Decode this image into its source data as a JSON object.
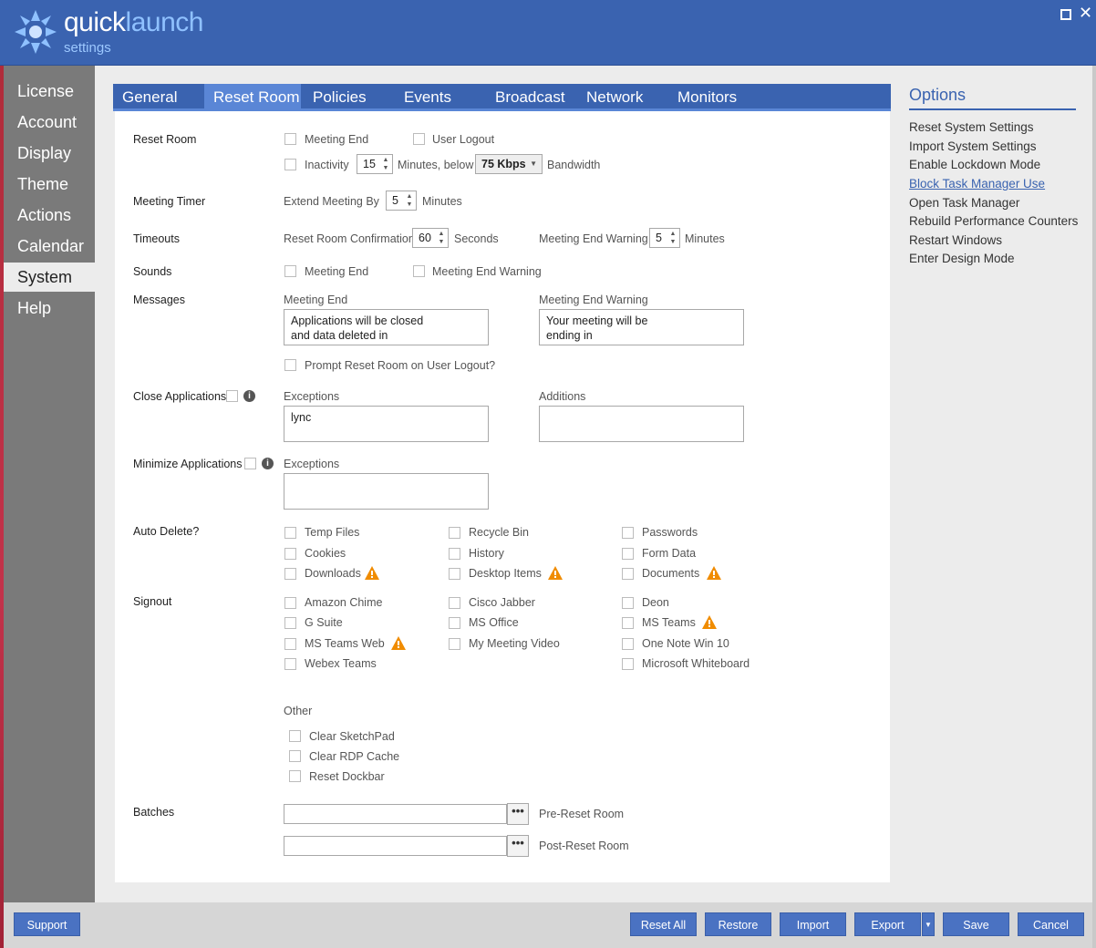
{
  "app": {
    "brand_quick": "quick",
    "brand_launch": "launch",
    "brand_sub": "settings",
    "accent": "#3a63b0",
    "warning_color": "#f08c00"
  },
  "window": {
    "maximize_icon": "maximize-icon",
    "close_icon": "close-icon"
  },
  "sidebar": {
    "items": [
      {
        "label": "License"
      },
      {
        "label": "Account"
      },
      {
        "label": "Display"
      },
      {
        "label": "Theme"
      },
      {
        "label": "Actions"
      },
      {
        "label": "Calendar"
      },
      {
        "label": "System",
        "active": true
      },
      {
        "label": "Help"
      }
    ]
  },
  "tabs": [
    {
      "label": "General"
    },
    {
      "label": "Reset Room",
      "active": true
    },
    {
      "label": "Policies"
    },
    {
      "label": "Events"
    },
    {
      "label": "Broadcast"
    },
    {
      "label": "Network"
    },
    {
      "label": "Monitors"
    }
  ],
  "reset_room": {
    "label": "Reset Room",
    "meeting_end": "Meeting End",
    "user_logout": "User Logout",
    "inactivity": "Inactivity",
    "inactivity_value": "15",
    "minutes_below": "Minutes, below",
    "bandwidth_value": "75 Kbps",
    "bandwidth": "Bandwidth"
  },
  "meeting_timer": {
    "label": "Meeting Timer",
    "extend_by": "Extend Meeting By",
    "value": "5",
    "minutes": "Minutes"
  },
  "timeouts": {
    "label": "Timeouts",
    "confirmation": "Reset Room Confirmation",
    "confirmation_value": "60",
    "seconds": "Seconds",
    "end_warning": "Meeting End Warning",
    "end_warning_value": "5",
    "minutes": "Minutes"
  },
  "sounds": {
    "label": "Sounds",
    "meeting_end": "Meeting End",
    "end_warning": "Meeting End Warning"
  },
  "messages": {
    "label": "Messages",
    "meeting_end_title": "Meeting End",
    "meeting_end_text": "Applications will be closed\nand data deleted in",
    "end_warning_title": "Meeting End Warning",
    "end_warning_text": "Your meeting will be\nending in",
    "prompt": "Prompt Reset Room on User Logout?"
  },
  "close_apps": {
    "label": "Close Applications",
    "exceptions": "Exceptions",
    "exceptions_value": "lync",
    "additions": "Additions",
    "additions_value": ""
  },
  "minimize_apps": {
    "label": "Minimize Applications",
    "exceptions": "Exceptions",
    "exceptions_value": ""
  },
  "auto_delete": {
    "label": "Auto Delete?",
    "col1": [
      "Temp Files",
      "Cookies",
      "Downloads"
    ],
    "col2": [
      "Recycle Bin",
      "History",
      "Desktop Items"
    ],
    "col3": [
      "Passwords",
      "Form Data",
      "Documents"
    ]
  },
  "signout": {
    "label": "Signout",
    "col1": [
      "Amazon Chime",
      "G Suite",
      "MS Teams Web",
      "Webex Teams"
    ],
    "col2": [
      "Cisco Jabber",
      "MS Office",
      "My Meeting Video"
    ],
    "col3": [
      "Deon",
      "MS Teams",
      "One Note Win 10",
      "Microsoft Whiteboard"
    ]
  },
  "other": {
    "label": "Other",
    "items": [
      "Clear SketchPad",
      "Clear RDP Cache",
      "Reset Dockbar"
    ]
  },
  "batches": {
    "label": "Batches",
    "pre_label": "Pre-Reset Room",
    "post_label": "Post-Reset Room",
    "browse": "•••",
    "pre_value": "",
    "post_value": ""
  },
  "options": {
    "title": "Options",
    "items": [
      {
        "label": "Reset System Settings"
      },
      {
        "label": "Import System Settings"
      },
      {
        "label": "Enable Lockdown Mode"
      },
      {
        "label": "Block Task Manager Use",
        "link": true
      },
      {
        "label": "Open Task Manager"
      },
      {
        "label": "Rebuild Performance Counters"
      },
      {
        "label": "Restart Windows"
      },
      {
        "label": "Enter Design Mode"
      }
    ]
  },
  "buttons": {
    "support": "Support",
    "reset_all": "Reset All",
    "restore": "Restore",
    "import": "Import",
    "export": "Export",
    "save": "Save",
    "cancel": "Cancel"
  }
}
